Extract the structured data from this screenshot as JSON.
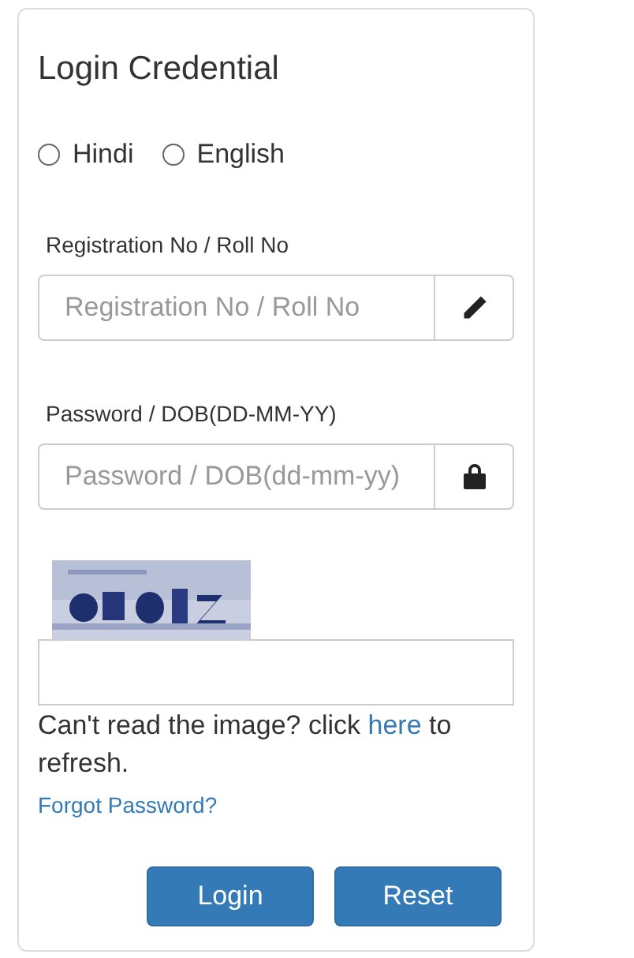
{
  "title": "Login Credential",
  "language_options": [
    {
      "label": "Hindi",
      "selected": false
    },
    {
      "label": "English",
      "selected": false
    }
  ],
  "fields": [
    {
      "label": "Registration No / Roll No",
      "placeholder": "Registration No / Roll No",
      "kind": "pencil"
    },
    {
      "label": "Password / DOB(DD-MM-YY)",
      "placeholder": "Password / DOB(dd-mm-yy)",
      "kind": "lock"
    }
  ],
  "captcha_hint": {
    "before": "Can't read the image? click",
    "link": "here",
    "after": "to refresh."
  },
  "forgot_link": "Forgot Password?",
  "buttons": [
    "Login",
    "Reset"
  ]
}
